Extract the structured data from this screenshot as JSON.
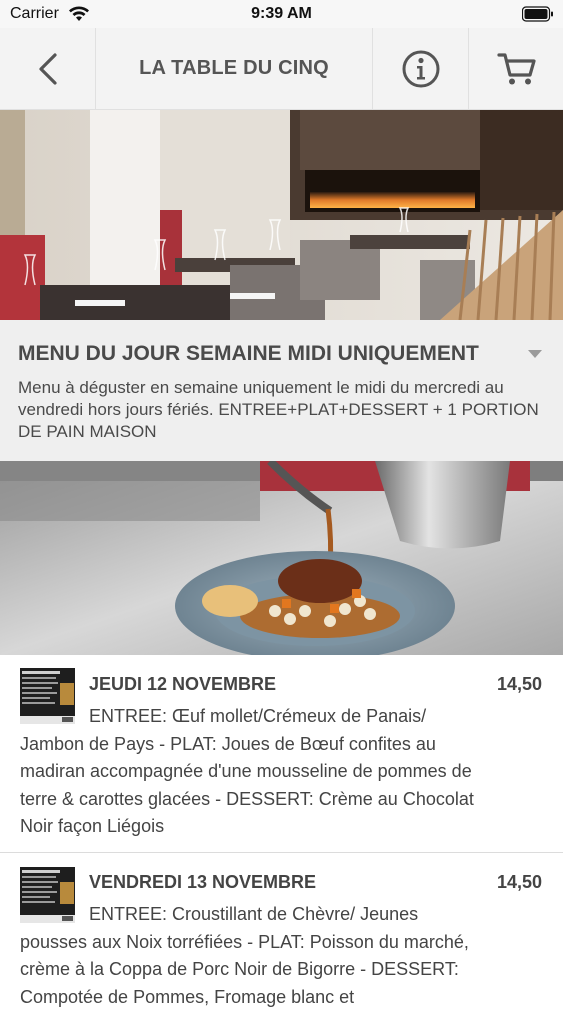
{
  "status_bar": {
    "carrier": "Carrier",
    "time": "9:39 AM"
  },
  "header": {
    "title": "LA TABLE DU CINQ",
    "back_icon": "chevron-left-icon",
    "info_icon": "info-circle-icon",
    "cart_icon": "cart-icon"
  },
  "menu": {
    "title": "MENU DU JOUR SEMAINE MIDI UNIQUEMENT",
    "description": "Menu à déguster en semaine uniquement le midi du mercredi au vendredi hors jours fériés. ENTREE+PLAT+DESSERT + 1 PORTION DE PAIN MAISON"
  },
  "items": [
    {
      "name": "JEUDI 12 NOVEMBRE",
      "price": "14,50",
      "description": "ENTREE: Œuf mollet/Crémeux de Panais/ Jambon de Pays - PLAT: Joues de Bœuf confites au madiran accompagnée d'une mousseline de pommes de terre & carottes glacées - DESSERT: Crème au Chocolat Noir façon Liégois"
    },
    {
      "name": "VENDREDI 13 NOVEMBRE",
      "price": "14,50",
      "description": "ENTREE: Croustillant de Chèvre/ Jeunes pousses aux Noix torréfiées - PLAT: Poisson du marché, crème à la Coppa de Porc Noir de Bigorre - DESSERT: Compotée de Pommes, Fromage blanc et"
    }
  ],
  "colors": {
    "header_bg": "#f3f3f3",
    "section_bg": "#efefef",
    "text": "#444444"
  }
}
